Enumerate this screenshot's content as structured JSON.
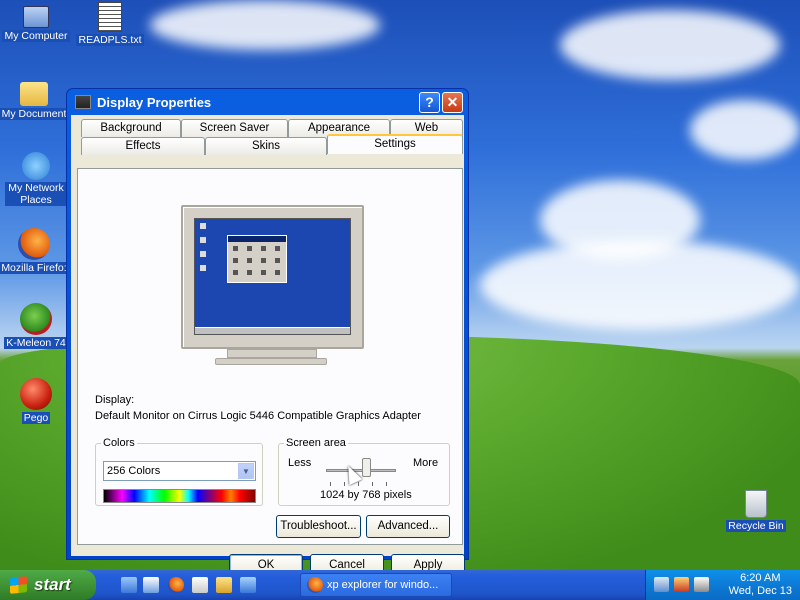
{
  "desktop": {
    "icons": [
      {
        "label": "My Computer"
      },
      {
        "label": "READPLS.txt"
      },
      {
        "label": "My Document"
      },
      {
        "label": "My Network Places"
      },
      {
        "label": "Mozilla Firefo:"
      },
      {
        "label": "K-Meleon 74"
      },
      {
        "label": "Pego"
      },
      {
        "label": "Recycle Bin"
      }
    ]
  },
  "window": {
    "title": "Display Properties",
    "help_label": "?",
    "close_label": "✕",
    "tabs_row1": [
      "Background",
      "Screen Saver",
      "Appearance",
      "Web"
    ],
    "tabs_row2": [
      "Effects",
      "Skins",
      "Settings"
    ],
    "active_tab": "Settings",
    "display_label": "Display:",
    "display_value": "Default Monitor on Cirrus Logic 5446 Compatible Graphics Adapter",
    "colors": {
      "legend": "Colors",
      "selected": "256 Colors"
    },
    "screen_area": {
      "legend": "Screen area",
      "less": "Less",
      "more": "More",
      "value": "1024 by 768 pixels"
    },
    "buttons": {
      "troubleshoot": "Troubleshoot...",
      "advanced": "Advanced...",
      "ok": "OK",
      "cancel": "Cancel",
      "apply": "Apply"
    }
  },
  "taskbar": {
    "start_label": "start",
    "task_label": "xp explorer for windo...",
    "time": "6:20 AM",
    "date": "Wed, Dec 13"
  }
}
